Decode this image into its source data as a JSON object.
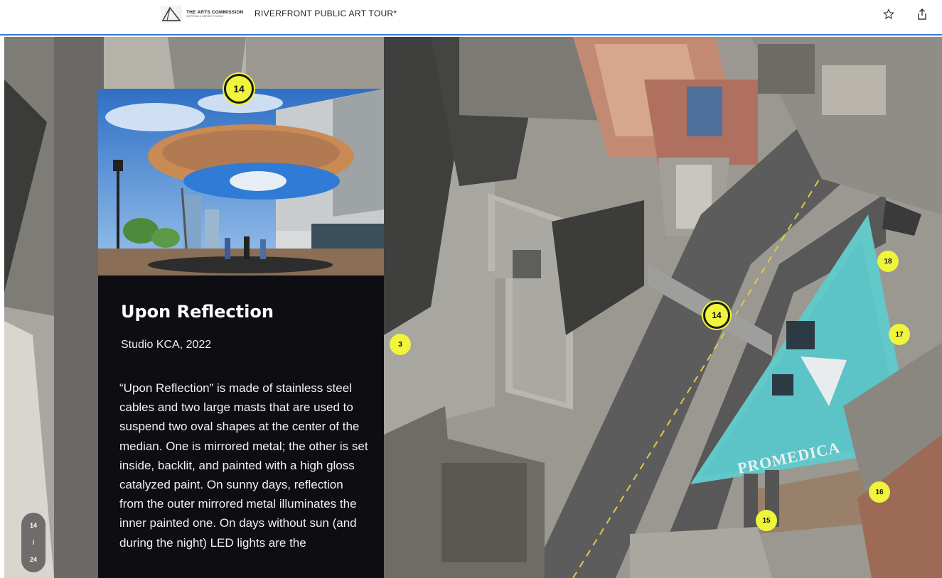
{
  "header": {
    "logo": {
      "name": "THE ARTS COMMISSION",
      "tagline": "INSPIRING A VIBRANT TOLEDO"
    },
    "title": "RIVERFRONT PUBLIC ART TOUR*",
    "favorite_icon": "star-outline-icon",
    "share_icon": "share-icon"
  },
  "panel": {
    "marker_number": "14",
    "artwork_title": "Upon Reflection",
    "artist_year": "Studio KCA, 2022",
    "description": "“Upon Reflection” is made of stainless steel cables and two large masts that are used to suspend two oval shapes at the center of the median. One is mirrored metal; the other is set inside, backlit, and painted with a high gloss catalyzed paint. On sunny days, reflection from the outer mirrored metal illuminates the inner painted one. On days without sun (and during the night) LED lights are the"
  },
  "map": {
    "building_sign": "PROMEDICA",
    "markers": [
      {
        "number": "3"
      },
      {
        "number": "14"
      },
      {
        "number": "15"
      },
      {
        "number": "16"
      },
      {
        "number": "17"
      },
      {
        "number": "18"
      }
    ]
  },
  "pager": {
    "current": "14",
    "separator": "/",
    "total": "24"
  },
  "colors": {
    "marker_fill": "#f0f43a",
    "panel_bg": "#0d0d12",
    "header_rule": "#3a7bd5"
  }
}
